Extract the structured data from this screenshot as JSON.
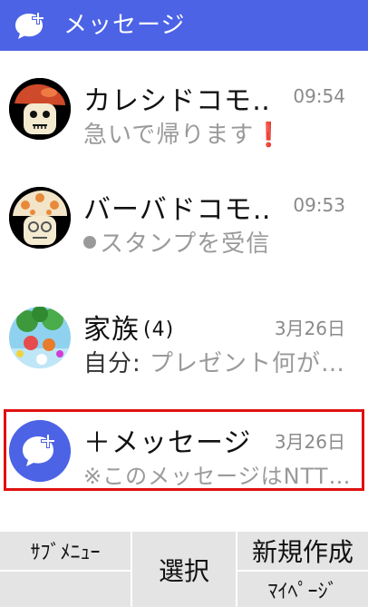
{
  "header": {
    "title": "メッセージ"
  },
  "threads": [
    {
      "name": "カレシドコモ‥",
      "count": "",
      "time": "09:54",
      "prefix": "",
      "preview": "急いで帰ります",
      "alert": "❗"
    },
    {
      "name": "バーバドコモ‥",
      "count": "",
      "time": "09:53",
      "prefix": "",
      "preview": "スタンプを受信",
      "alert": ""
    },
    {
      "name": "家族",
      "count": "(4)",
      "time": "3月26日",
      "prefix": "自分: ",
      "preview": "プレゼント何が…",
      "alert": ""
    },
    {
      "name": "＋メッセージ",
      "count": "",
      "time": "3月26日",
      "prefix": "",
      "preview": "※このメッセージはNTT…",
      "alert": ""
    }
  ],
  "softkeys": {
    "submenu": "ｻﾌﾞﾒﾆｭｰ",
    "select": "選択",
    "new": "新規作成",
    "mypage": "ﾏｲﾍﾟｰｼﾞ"
  },
  "colors": {
    "header": "#4c63e6",
    "highlight": "#e01010",
    "softkey_bg": "#e4e4e4"
  }
}
